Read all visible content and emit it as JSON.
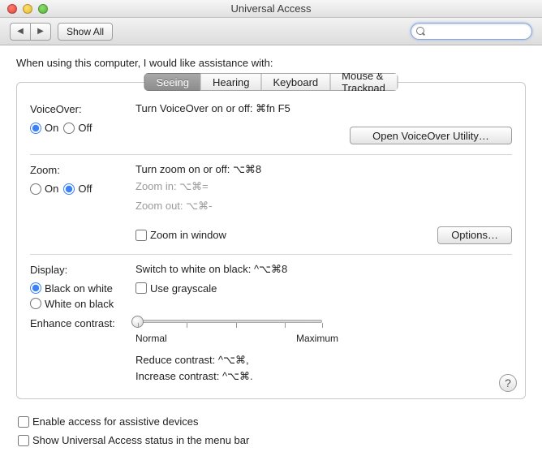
{
  "window": {
    "title": "Universal Access"
  },
  "toolbar": {
    "back": "◀",
    "forward": "▶",
    "showAll": "Show All",
    "searchPlaceholder": ""
  },
  "intro": "When using this computer, I would like assistance with:",
  "tabs": {
    "seeing": "Seeing",
    "hearing": "Hearing",
    "keyboard": "Keyboard",
    "mouse": "Mouse & Trackpad"
  },
  "voiceover": {
    "label": "VoiceOver:",
    "help": "Turn VoiceOver on or off: ⌘fn F5",
    "on": "On",
    "off": "Off",
    "button": "Open VoiceOver Utility…"
  },
  "zoom": {
    "label": "Zoom:",
    "help": "Turn zoom on or off: ⌥⌘8",
    "zoomIn": "Zoom in:  ⌥⌘=",
    "zoomOut": "Zoom out: ⌥⌘-",
    "on": "On",
    "off": "Off",
    "inWindow": "Zoom in window",
    "options": "Options…"
  },
  "display": {
    "label": "Display:",
    "help": "Switch to white on black: ^⌥⌘8",
    "bw": "Black on white",
    "wb": "White on black",
    "gray": "Use grayscale"
  },
  "contrast": {
    "label": "Enhance contrast:",
    "normal": "Normal",
    "max": "Maximum",
    "reduce": "Reduce contrast: ^⌥⌘,",
    "increase": "Increase contrast: ^⌥⌘."
  },
  "help": "?",
  "footer": {
    "assistive": "Enable access for assistive devices",
    "menubar": "Show Universal Access status in the menu bar"
  }
}
